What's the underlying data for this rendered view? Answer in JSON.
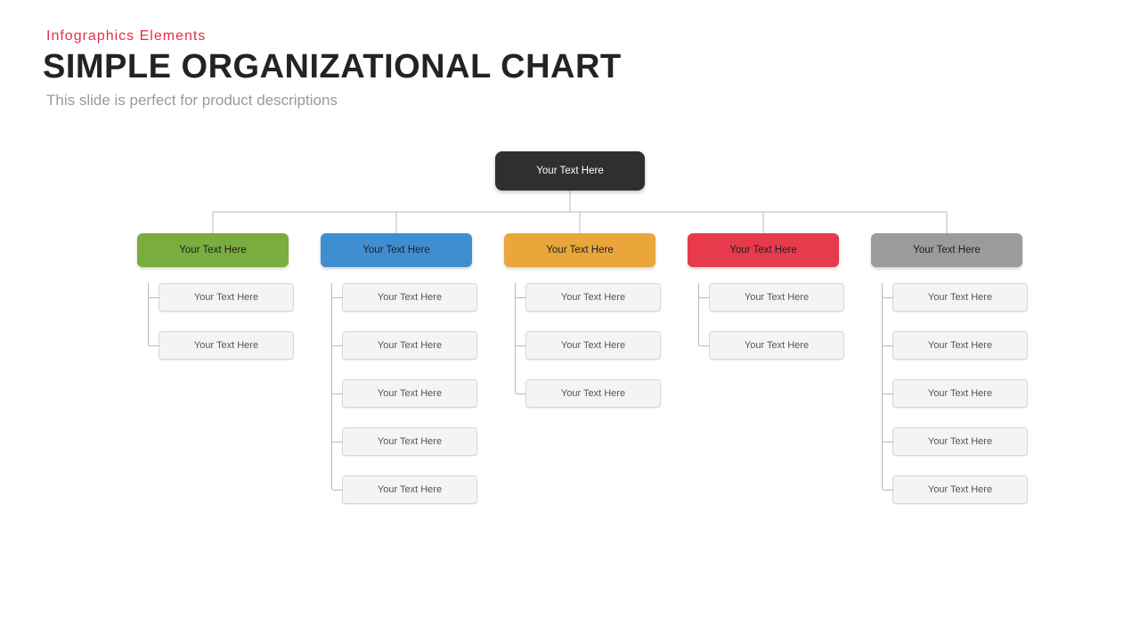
{
  "header": {
    "kicker": "Infographics  Elements",
    "title": "SIMPLE ORGANIZATIONAL CHART",
    "subtitle": "This slide is perfect for product descriptions"
  },
  "colors": {
    "root": "#2f2f2f",
    "branches": [
      "#7aad3f",
      "#3f8ed1",
      "#eaa63b",
      "#e83a4d",
      "#9b9b9b"
    ]
  },
  "root": {
    "label": "Your Text Here"
  },
  "branches": [
    {
      "label": "Your Text Here",
      "children": [
        "Your Text Here",
        "Your Text Here"
      ]
    },
    {
      "label": "Your Text Here",
      "children": [
        "Your Text Here",
        "Your Text Here",
        "Your Text Here",
        "Your Text Here",
        "Your Text Here"
      ]
    },
    {
      "label": "Your Text Here",
      "children": [
        "Your Text Here",
        "Your Text Here",
        "Your Text Here"
      ]
    },
    {
      "label": "Your Text Here",
      "children": [
        "Your Text Here",
        "Your Text Here"
      ]
    },
    {
      "label": "Your Text Here",
      "children": [
        "Your Text Here",
        "Your Text Here",
        "Your Text Here",
        "Your Text Here",
        "Your Text Here"
      ]
    }
  ],
  "layout": {
    "branch_lefts": [
      154,
      360,
      566,
      772,
      978
    ],
    "child_pitch": 54
  }
}
